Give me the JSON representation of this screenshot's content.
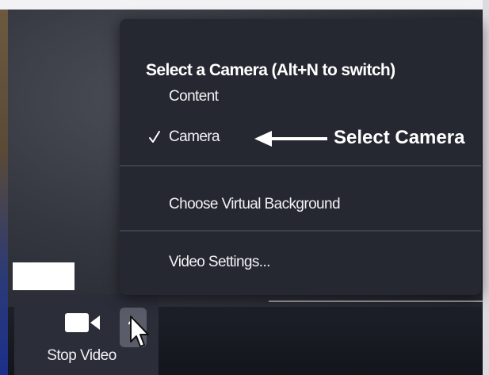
{
  "toolbar": {
    "stop_video_label": "Stop Video"
  },
  "camera_menu": {
    "heading": "Select a Camera (Alt+N to switch)",
    "items": [
      {
        "label": "Content",
        "checked": false
      },
      {
        "label": "Camera",
        "checked": true
      }
    ],
    "virtual_background_label": "Choose Virtual Background",
    "video_settings_label": "Video Settings..."
  },
  "annotation": {
    "text": "Select Camera"
  },
  "icons": {
    "video": "video-camera-icon",
    "caret": "chevron-up-icon",
    "check": "checkmark-icon",
    "cursor": "mouse-pointer-icon",
    "annotation_arrow": "left-arrow-icon"
  },
  "colors": {
    "menu_background": "#252731",
    "panel_background": "#2b2d38",
    "caret_button": "#5a5c69",
    "text": "#ffffff"
  }
}
